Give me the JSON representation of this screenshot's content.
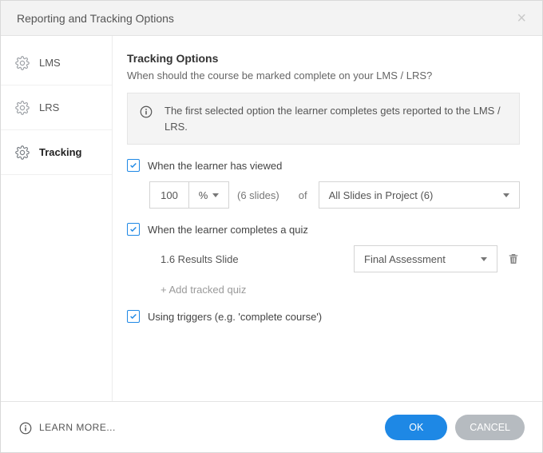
{
  "dialog": {
    "title": "Reporting and Tracking Options"
  },
  "sidebar": {
    "items": [
      {
        "label": "LMS"
      },
      {
        "label": "LRS"
      },
      {
        "label": "Tracking"
      }
    ],
    "selected": 2
  },
  "main": {
    "heading": "Tracking Options",
    "subheading": "When should the course be marked complete on your LMS / LRS?",
    "info": "The first selected option the learner completes gets reported to the LMS / LRS."
  },
  "viewed": {
    "checked": true,
    "label": "When the learner has viewed",
    "value": "100",
    "unit": "%",
    "count_hint": "(6 slides)",
    "of_label": "of",
    "scope": "All Slides in Project (6)"
  },
  "quiz": {
    "checked": true,
    "label": "When the learner completes a quiz",
    "item_label": "1.6 Results Slide",
    "selected": "Final Assessment",
    "add_label": "+ Add tracked quiz"
  },
  "triggers": {
    "checked": true,
    "label": "Using triggers (e.g. 'complete course')"
  },
  "footer": {
    "learn_more": "LEARN MORE...",
    "ok": "OK",
    "cancel": "CANCEL"
  }
}
